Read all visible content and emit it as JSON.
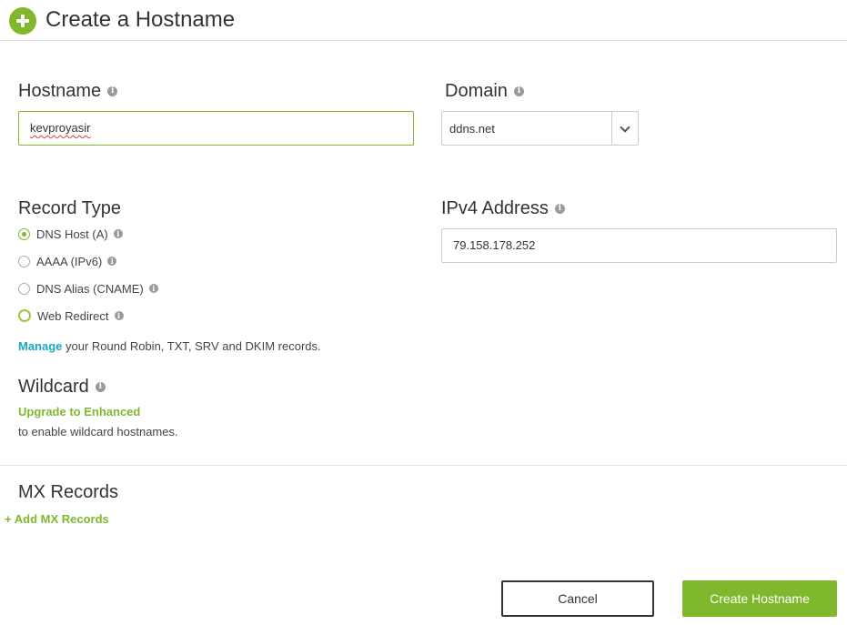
{
  "header": {
    "title": "Create a Hostname",
    "icon": "plus-circle-icon"
  },
  "hostname": {
    "label": "Hostname",
    "value": "kevproyasir"
  },
  "domain": {
    "label": "Domain",
    "value": "ddns.net"
  },
  "record_type": {
    "label": "Record Type",
    "options": [
      {
        "label": "DNS Host (A)",
        "checked": true
      },
      {
        "label": "AAAA (IPv6)",
        "checked": false
      },
      {
        "label": "DNS Alias (CNAME)",
        "checked": false
      },
      {
        "label": "Web Redirect",
        "checked": false
      }
    ],
    "manage_link": "Manage",
    "manage_text": " your Round Robin, TXT, SRV and DKIM records."
  },
  "ipv4": {
    "label": "IPv4 Address",
    "value": "79.158.178.252"
  },
  "wildcard": {
    "label": "Wildcard",
    "upgrade_link": "Upgrade to Enhanced",
    "text": "to enable wildcard hostnames."
  },
  "mx": {
    "label": "MX Records",
    "add_link": "Add MX Records"
  },
  "buttons": {
    "cancel": "Cancel",
    "create": "Create Hostname"
  },
  "colors": {
    "accent": "#7fb82d",
    "link": "#1aa7c4"
  }
}
